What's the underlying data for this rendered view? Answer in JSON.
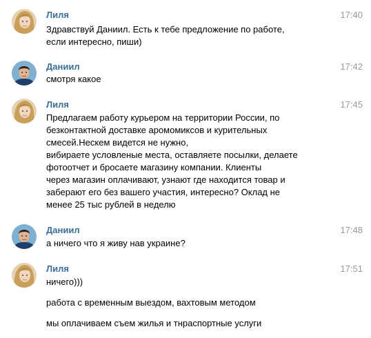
{
  "colors": {
    "sender_name": "#3a6d99",
    "timestamp": "#999999",
    "text": "#000000",
    "background": "#ffffff"
  },
  "messages": [
    {
      "sender": "Лиля",
      "time": "17:40",
      "avatar": "liliya-avatar",
      "lines": [
        "Здравствуй Даниил. Есть к тебе предложение по работе,\nесли интересно, пиши)"
      ]
    },
    {
      "sender": "Даниил",
      "time": "17:42",
      "avatar": "daniil-avatar",
      "lines": [
        "смотря какое"
      ]
    },
    {
      "sender": "Лиля",
      "time": "17:45",
      "avatar": "liliya-avatar",
      "lines": [
        "Предлагаем работу курьером на территории России, по\nбезконтактной доставке аромомиксов и курительных\nсмесей.Нескем видется не нужно,\nвибираете условленые места, оставляете посылки, делаете\nфотоотчет и бросаете магазину компании. Клиенты\nчерез магазин оплачивают, узнают где находится товар и\nзаберают его без вашего участия, интересно? Оклад не\nменее 25 тыс рублей в неделю"
      ]
    },
    {
      "sender": "Даниил",
      "time": "17:48",
      "avatar": "daniil-avatar",
      "lines": [
        "а ничего что я живу нав украине?"
      ]
    },
    {
      "sender": "Лиля",
      "time": "17:51",
      "avatar": "liliya-avatar",
      "lines": [
        "ничего)))",
        "работа с временным выездом, вахтовым методом",
        "мы оплачиваем съем жилья и тнраспортные услуги"
      ]
    }
  ]
}
